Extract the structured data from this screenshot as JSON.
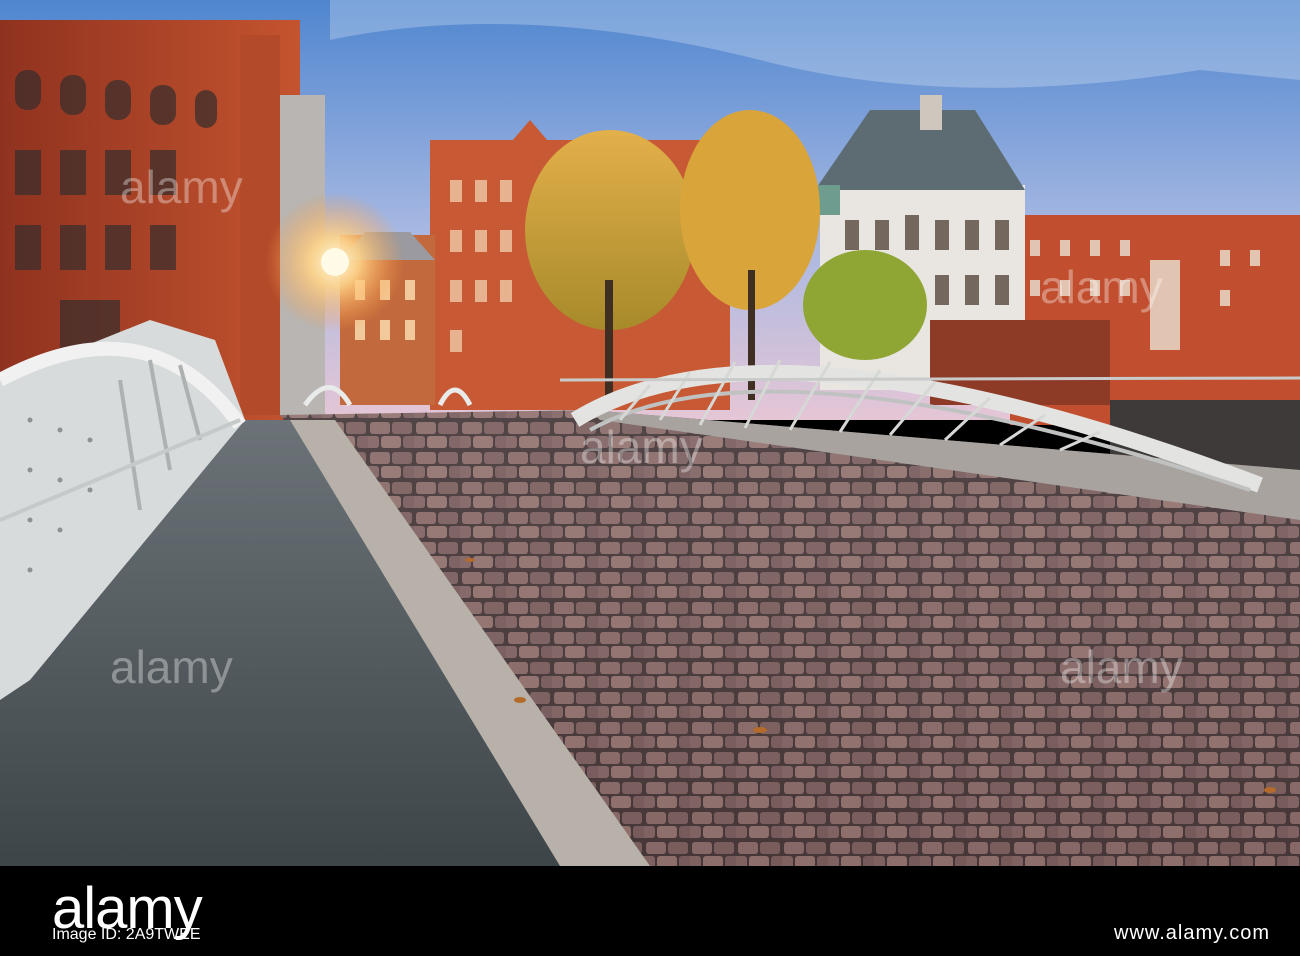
{
  "watermark": {
    "brand": "alamy",
    "image_id": "2A9TWEE"
  },
  "banner": {
    "brand": "alamy",
    "image_id_label": "Image ID: 2A9TWEE",
    "image_id_right": "www.alamy.com"
  },
  "colors": {
    "sky_top": "#5b8fd1",
    "sky_bottom": "#d8b8d9",
    "brick": "#b5432a",
    "cobblestone": "#8a6e6a",
    "bridge_white": "#d9dcdc"
  }
}
